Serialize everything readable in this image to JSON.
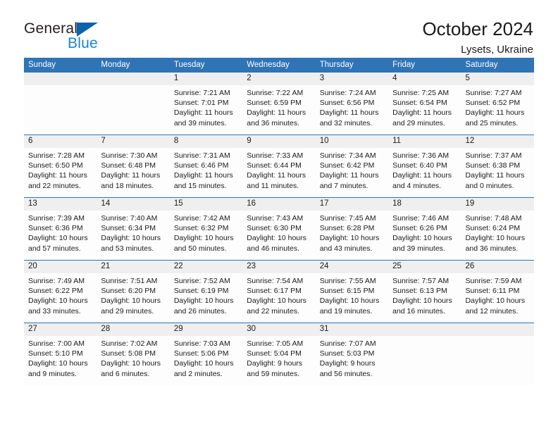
{
  "brand": {
    "name_top": "General",
    "name_bottom": "Blue",
    "triangle_icon": "triangle-icon",
    "color_top": "#231f20",
    "color_bottom": "#1b84d0",
    "accent": "#0b63ac"
  },
  "header": {
    "title": "October 2024",
    "subtitle": "Lysets, Ukraine"
  },
  "theme": {
    "header_blue": "#2f74b5",
    "daynum_band": "#efefef",
    "cell_bg": "#fdfdfd"
  },
  "calendar": {
    "weekday_headers": [
      "Sunday",
      "Monday",
      "Tuesday",
      "Wednesday",
      "Thursday",
      "Friday",
      "Saturday"
    ],
    "weeks": [
      [
        {
          "day": "",
          "sunrise": "",
          "sunset": "",
          "daylight": ""
        },
        {
          "day": "",
          "sunrise": "",
          "sunset": "",
          "daylight": ""
        },
        {
          "day": "1",
          "sunrise": "Sunrise: 7:21 AM",
          "sunset": "Sunset: 7:01 PM",
          "daylight": "Daylight: 11 hours and 39 minutes."
        },
        {
          "day": "2",
          "sunrise": "Sunrise: 7:22 AM",
          "sunset": "Sunset: 6:59 PM",
          "daylight": "Daylight: 11 hours and 36 minutes."
        },
        {
          "day": "3",
          "sunrise": "Sunrise: 7:24 AM",
          "sunset": "Sunset: 6:56 PM",
          "daylight": "Daylight: 11 hours and 32 minutes."
        },
        {
          "day": "4",
          "sunrise": "Sunrise: 7:25 AM",
          "sunset": "Sunset: 6:54 PM",
          "daylight": "Daylight: 11 hours and 29 minutes."
        },
        {
          "day": "5",
          "sunrise": "Sunrise: 7:27 AM",
          "sunset": "Sunset: 6:52 PM",
          "daylight": "Daylight: 11 hours and 25 minutes."
        }
      ],
      [
        {
          "day": "6",
          "sunrise": "Sunrise: 7:28 AM",
          "sunset": "Sunset: 6:50 PM",
          "daylight": "Daylight: 11 hours and 22 minutes."
        },
        {
          "day": "7",
          "sunrise": "Sunrise: 7:30 AM",
          "sunset": "Sunset: 6:48 PM",
          "daylight": "Daylight: 11 hours and 18 minutes."
        },
        {
          "day": "8",
          "sunrise": "Sunrise: 7:31 AM",
          "sunset": "Sunset: 6:46 PM",
          "daylight": "Daylight: 11 hours and 15 minutes."
        },
        {
          "day": "9",
          "sunrise": "Sunrise: 7:33 AM",
          "sunset": "Sunset: 6:44 PM",
          "daylight": "Daylight: 11 hours and 11 minutes."
        },
        {
          "day": "10",
          "sunrise": "Sunrise: 7:34 AM",
          "sunset": "Sunset: 6:42 PM",
          "daylight": "Daylight: 11 hours and 7 minutes."
        },
        {
          "day": "11",
          "sunrise": "Sunrise: 7:36 AM",
          "sunset": "Sunset: 6:40 PM",
          "daylight": "Daylight: 11 hours and 4 minutes."
        },
        {
          "day": "12",
          "sunrise": "Sunrise: 7:37 AM",
          "sunset": "Sunset: 6:38 PM",
          "daylight": "Daylight: 11 hours and 0 minutes."
        }
      ],
      [
        {
          "day": "13",
          "sunrise": "Sunrise: 7:39 AM",
          "sunset": "Sunset: 6:36 PM",
          "daylight": "Daylight: 10 hours and 57 minutes."
        },
        {
          "day": "14",
          "sunrise": "Sunrise: 7:40 AM",
          "sunset": "Sunset: 6:34 PM",
          "daylight": "Daylight: 10 hours and 53 minutes."
        },
        {
          "day": "15",
          "sunrise": "Sunrise: 7:42 AM",
          "sunset": "Sunset: 6:32 PM",
          "daylight": "Daylight: 10 hours and 50 minutes."
        },
        {
          "day": "16",
          "sunrise": "Sunrise: 7:43 AM",
          "sunset": "Sunset: 6:30 PM",
          "daylight": "Daylight: 10 hours and 46 minutes."
        },
        {
          "day": "17",
          "sunrise": "Sunrise: 7:45 AM",
          "sunset": "Sunset: 6:28 PM",
          "daylight": "Daylight: 10 hours and 43 minutes."
        },
        {
          "day": "18",
          "sunrise": "Sunrise: 7:46 AM",
          "sunset": "Sunset: 6:26 PM",
          "daylight": "Daylight: 10 hours and 39 minutes."
        },
        {
          "day": "19",
          "sunrise": "Sunrise: 7:48 AM",
          "sunset": "Sunset: 6:24 PM",
          "daylight": "Daylight: 10 hours and 36 minutes."
        }
      ],
      [
        {
          "day": "20",
          "sunrise": "Sunrise: 7:49 AM",
          "sunset": "Sunset: 6:22 PM",
          "daylight": "Daylight: 10 hours and 33 minutes."
        },
        {
          "day": "21",
          "sunrise": "Sunrise: 7:51 AM",
          "sunset": "Sunset: 6:20 PM",
          "daylight": "Daylight: 10 hours and 29 minutes."
        },
        {
          "day": "22",
          "sunrise": "Sunrise: 7:52 AM",
          "sunset": "Sunset: 6:19 PM",
          "daylight": "Daylight: 10 hours and 26 minutes."
        },
        {
          "day": "23",
          "sunrise": "Sunrise: 7:54 AM",
          "sunset": "Sunset: 6:17 PM",
          "daylight": "Daylight: 10 hours and 22 minutes."
        },
        {
          "day": "24",
          "sunrise": "Sunrise: 7:55 AM",
          "sunset": "Sunset: 6:15 PM",
          "daylight": "Daylight: 10 hours and 19 minutes."
        },
        {
          "day": "25",
          "sunrise": "Sunrise: 7:57 AM",
          "sunset": "Sunset: 6:13 PM",
          "daylight": "Daylight: 10 hours and 16 minutes."
        },
        {
          "day": "26",
          "sunrise": "Sunrise: 7:59 AM",
          "sunset": "Sunset: 6:11 PM",
          "daylight": "Daylight: 10 hours and 12 minutes."
        }
      ],
      [
        {
          "day": "27",
          "sunrise": "Sunrise: 7:00 AM",
          "sunset": "Sunset: 5:10 PM",
          "daylight": "Daylight: 10 hours and 9 minutes."
        },
        {
          "day": "28",
          "sunrise": "Sunrise: 7:02 AM",
          "sunset": "Sunset: 5:08 PM",
          "daylight": "Daylight: 10 hours and 6 minutes."
        },
        {
          "day": "29",
          "sunrise": "Sunrise: 7:03 AM",
          "sunset": "Sunset: 5:06 PM",
          "daylight": "Daylight: 10 hours and 2 minutes."
        },
        {
          "day": "30",
          "sunrise": "Sunrise: 7:05 AM",
          "sunset": "Sunset: 5:04 PM",
          "daylight": "Daylight: 9 hours and 59 minutes."
        },
        {
          "day": "31",
          "sunrise": "Sunrise: 7:07 AM",
          "sunset": "Sunset: 5:03 PM",
          "daylight": "Daylight: 9 hours and 56 minutes."
        },
        {
          "day": "",
          "sunrise": "",
          "sunset": "",
          "daylight": ""
        },
        {
          "day": "",
          "sunrise": "",
          "sunset": "",
          "daylight": ""
        }
      ]
    ]
  }
}
